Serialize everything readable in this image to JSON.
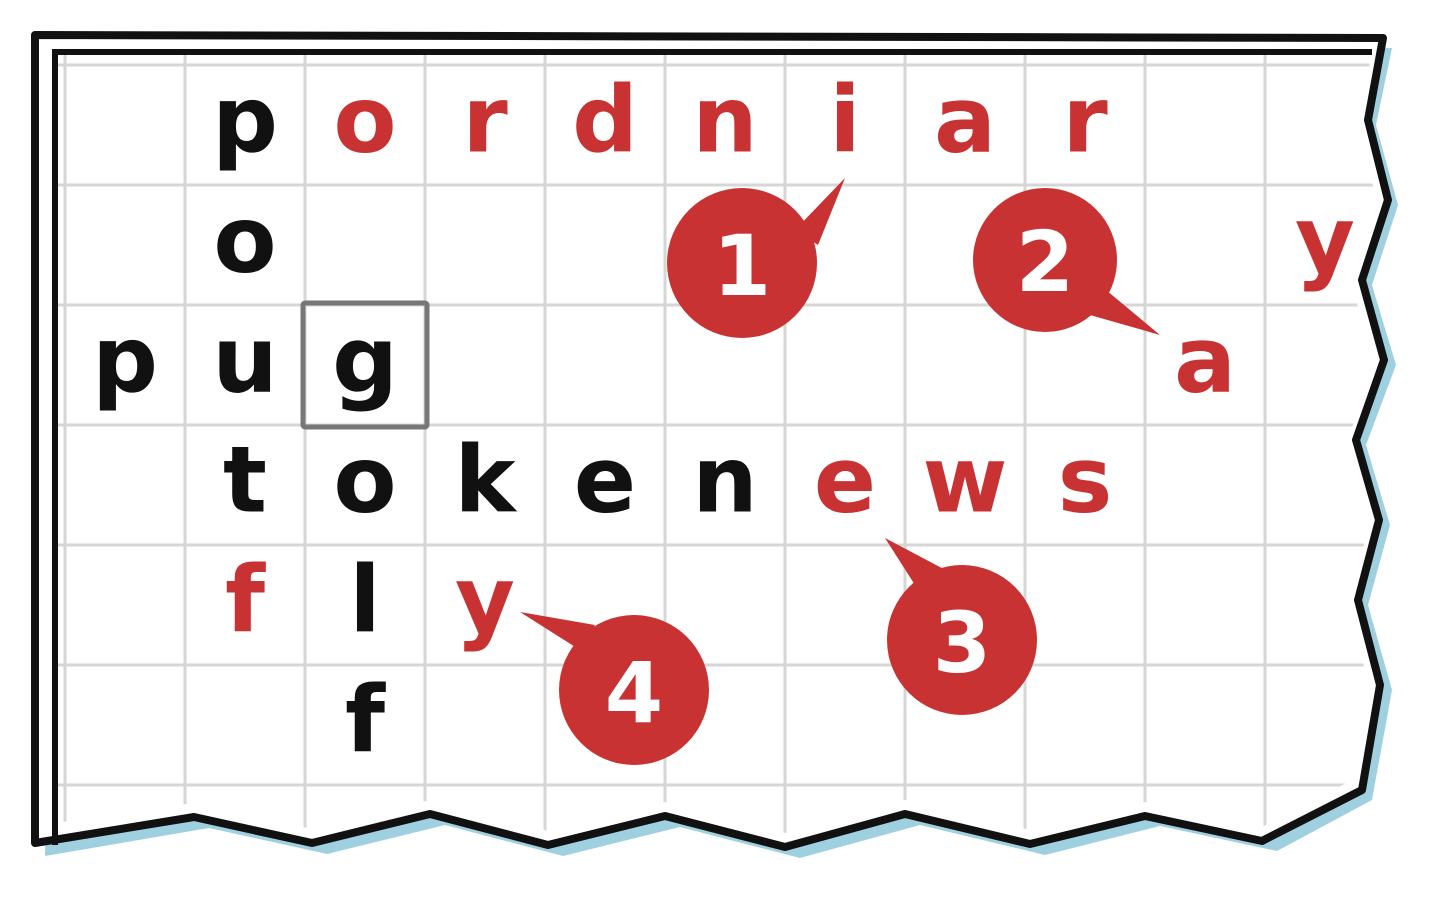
{
  "colors": {
    "paper": "#ffffff",
    "grid_line": "#d6d6d6",
    "border": "#111111",
    "shadow": "#9fd0e0",
    "black_letter": "#111111",
    "red_letter": "#c93232",
    "badge_fill": "#c93232",
    "badge_text": "#ffffff",
    "selected_cell_outline": "#777777"
  },
  "grid": {
    "columns": 11,
    "rows": 6,
    "selected_cell": {
      "row": 3,
      "col": 3
    }
  },
  "letters": [
    {
      "row": 1,
      "col": 2,
      "char": "p",
      "color": "black"
    },
    {
      "row": 1,
      "col": 3,
      "char": "o",
      "color": "red"
    },
    {
      "row": 1,
      "col": 4,
      "char": "r",
      "color": "red"
    },
    {
      "row": 1,
      "col": 5,
      "char": "d",
      "color": "red"
    },
    {
      "row": 1,
      "col": 6,
      "char": "n",
      "color": "red"
    },
    {
      "row": 1,
      "col": 7,
      "char": "i",
      "color": "red"
    },
    {
      "row": 1,
      "col": 8,
      "char": "a",
      "color": "red"
    },
    {
      "row": 1,
      "col": 9,
      "char": "r",
      "color": "red"
    },
    {
      "row": 2,
      "col": 2,
      "char": "o",
      "color": "black"
    },
    {
      "row": 2,
      "col": 11,
      "char": "y",
      "color": "red"
    },
    {
      "row": 3,
      "col": 1,
      "char": "p",
      "color": "black"
    },
    {
      "row": 3,
      "col": 2,
      "char": "u",
      "color": "black"
    },
    {
      "row": 3,
      "col": 3,
      "char": "g",
      "color": "black"
    },
    {
      "row": 3,
      "col": 10,
      "char": "a",
      "color": "red"
    },
    {
      "row": 4,
      "col": 2,
      "char": "t",
      "color": "black"
    },
    {
      "row": 4,
      "col": 3,
      "char": "o",
      "color": "black"
    },
    {
      "row": 4,
      "col": 4,
      "char": "k",
      "color": "black"
    },
    {
      "row": 4,
      "col": 5,
      "char": "e",
      "color": "black"
    },
    {
      "row": 4,
      "col": 6,
      "char": "n",
      "color": "black"
    },
    {
      "row": 4,
      "col": 7,
      "char": "e",
      "color": "red"
    },
    {
      "row": 4,
      "col": 8,
      "char": "w",
      "color": "red"
    },
    {
      "row": 4,
      "col": 9,
      "char": "s",
      "color": "red"
    },
    {
      "row": 5,
      "col": 2,
      "char": "f",
      "color": "red"
    },
    {
      "row": 5,
      "col": 3,
      "char": "l",
      "color": "black"
    },
    {
      "row": 5,
      "col": 4,
      "char": "y",
      "color": "red"
    },
    {
      "row": 6,
      "col": 3,
      "char": "f",
      "color": "black"
    }
  ],
  "badges": [
    {
      "number": "1",
      "points_to": "i in pordniar"
    },
    {
      "number": "2",
      "points_to": "a next to y"
    },
    {
      "number": "3",
      "points_to": "ews in tokenews"
    },
    {
      "number": "4",
      "points_to": "y in fly"
    }
  ]
}
